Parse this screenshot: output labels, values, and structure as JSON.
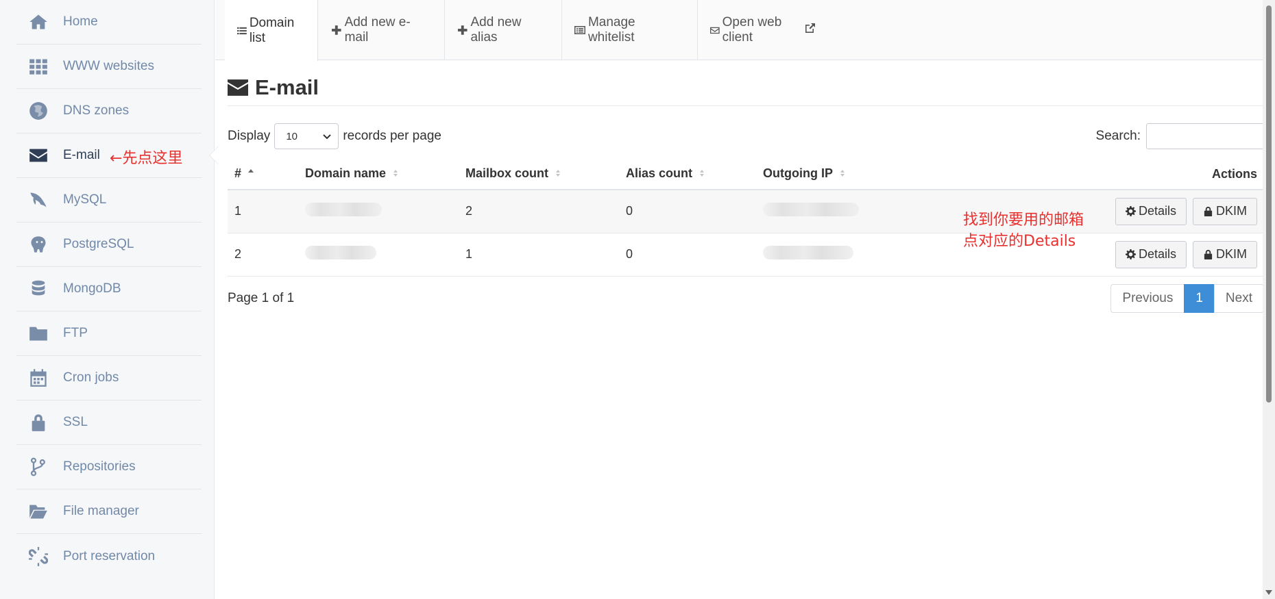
{
  "sidebar": {
    "items": [
      {
        "label": "Home",
        "icon": "home-icon"
      },
      {
        "label": "WWW websites",
        "icon": "grid-icon"
      },
      {
        "label": "DNS zones",
        "icon": "globe-icon"
      },
      {
        "label": "E-mail",
        "icon": "envelope-icon",
        "active": true,
        "annotation": "←先点这里"
      },
      {
        "label": "MySQL",
        "icon": "dolphin-icon"
      },
      {
        "label": "PostgreSQL",
        "icon": "elephant-icon"
      },
      {
        "label": "MongoDB",
        "icon": "database-icon"
      },
      {
        "label": "FTP",
        "icon": "folder-icon"
      },
      {
        "label": "Cron jobs",
        "icon": "calendar-icon"
      },
      {
        "label": "SSL",
        "icon": "lock-icon"
      },
      {
        "label": "Repositories",
        "icon": "git-branch-icon"
      },
      {
        "label": "File manager",
        "icon": "folder-open-icon"
      },
      {
        "label": "Port reservation",
        "icon": "unlink-icon"
      }
    ]
  },
  "tabs": [
    {
      "label": "Domain list",
      "icon": "list-icon",
      "active": true
    },
    {
      "label": "Add new e-mail",
      "icon": "plus-icon"
    },
    {
      "label": "Add new alias",
      "icon": "plus-icon"
    },
    {
      "label": "Manage whitelist",
      "icon": "list-alt-icon"
    },
    {
      "label": "Open web client",
      "icon": "envelope-o-icon",
      "trailing_icon": "external-link-icon"
    }
  ],
  "page": {
    "title": "E-mail",
    "display_label": "Display",
    "per_page_value": "10",
    "per_page_suffix": "records per page",
    "search_label": "Search:",
    "search_value": ""
  },
  "table": {
    "columns": [
      "#",
      "Domain name",
      "Mailbox count",
      "Alias count",
      "Outgoing IP",
      "Actions"
    ],
    "rows": [
      {
        "num": "1",
        "mailbox_count": "2",
        "alias_count": "0"
      },
      {
        "num": "2",
        "mailbox_count": "1",
        "alias_count": "0"
      }
    ],
    "details_label": "Details",
    "dkim_label": "DKIM"
  },
  "annotation": {
    "line1": "找到你要用的邮箱",
    "line2": "点对应的Details",
    "color": "#e8302e"
  },
  "footer": {
    "page_info": "Page 1 of 1",
    "pagination": {
      "previous": "Previous",
      "current": "1",
      "next": "Next"
    }
  },
  "colors": {
    "accent": "#3d8ed6",
    "sidebar_text": "#7189a9",
    "sidebar_active": "#2f3e55"
  }
}
